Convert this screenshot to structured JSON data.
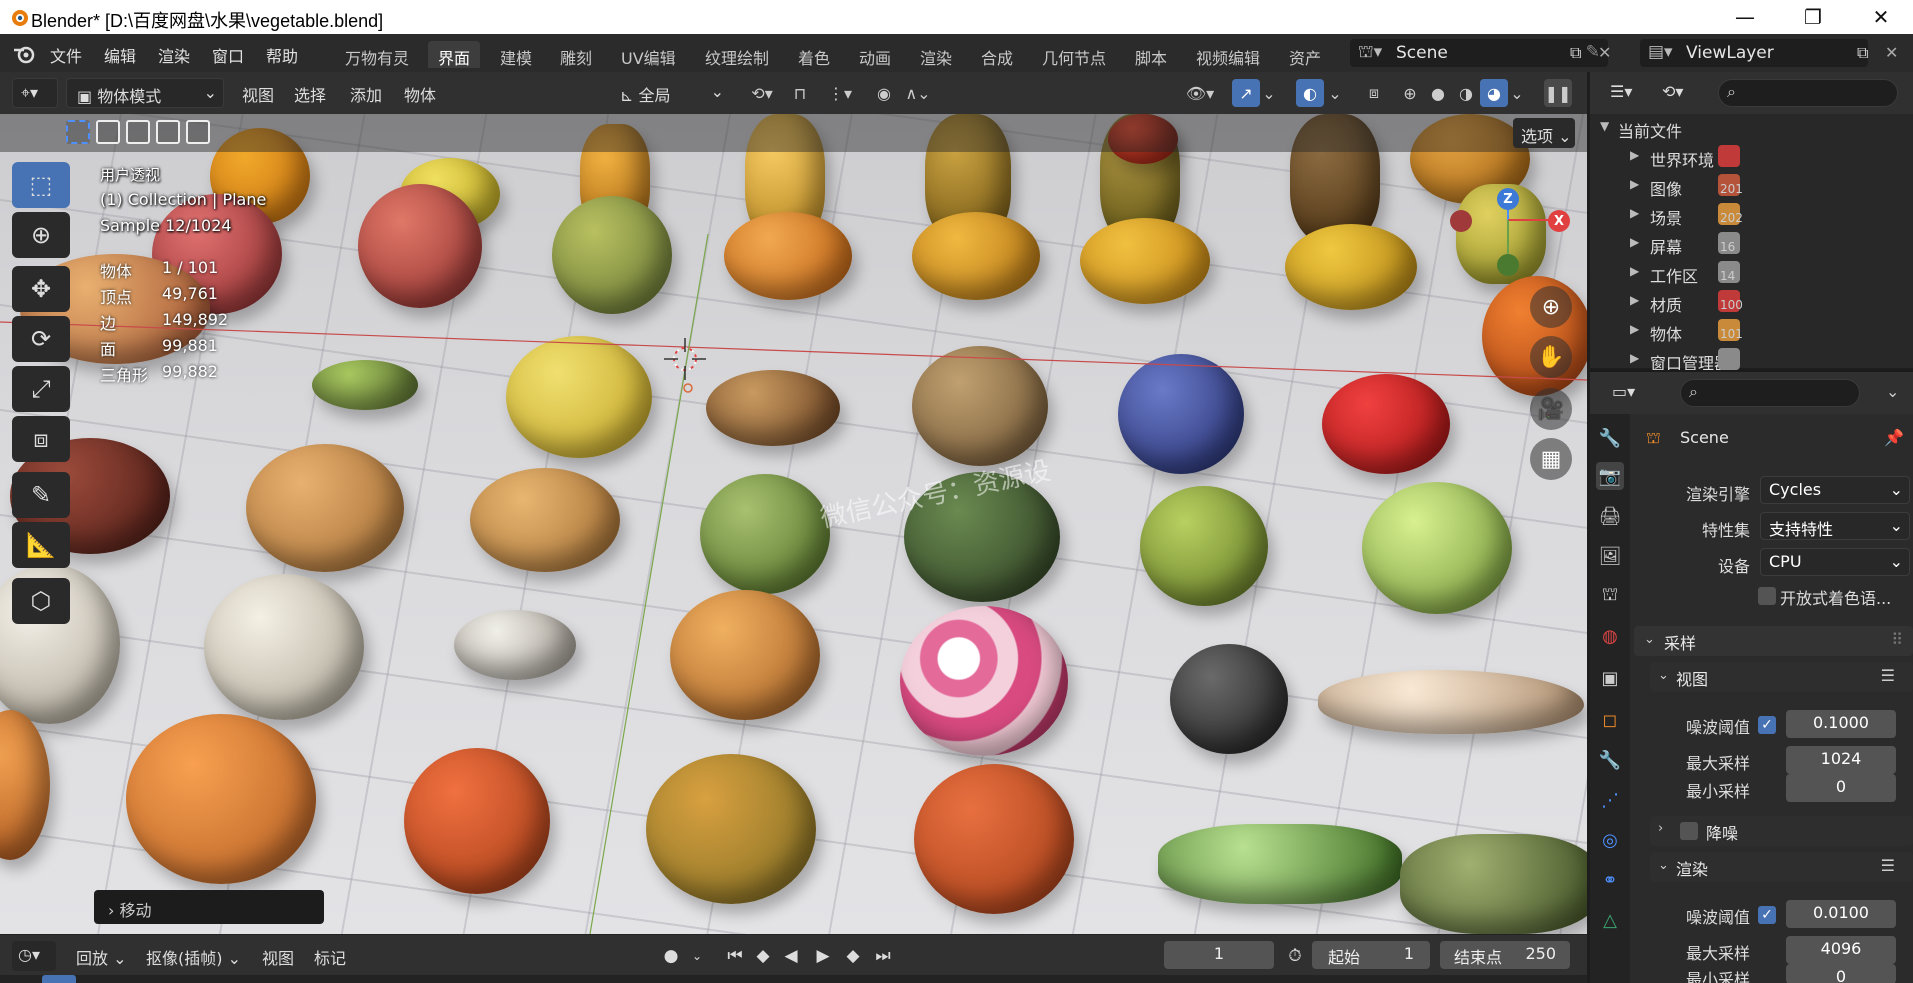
{
  "titlebar": {
    "title": "Blender* [D:\\百度网盘\\水果\\vegetable.blend]",
    "minimize": "—",
    "maximize": "❐",
    "close": "✕"
  },
  "menu": {
    "items": [
      "文件",
      "编辑",
      "渲染",
      "窗口",
      "帮助"
    ],
    "workspaces": [
      "万物有灵",
      "界面",
      "建模",
      "雕刻",
      "UV编辑",
      "纹理绘制",
      "着色",
      "动画",
      "渲染",
      "合成",
      "几何节点",
      "脚本",
      "视频编辑",
      "资产"
    ],
    "active_workspace": "界面",
    "scene": "Scene",
    "view_layer": "ViewLayer"
  },
  "viewport_header": {
    "mode": "物体模式",
    "menus": [
      "视图",
      "选择",
      "添加",
      "物体"
    ],
    "transform_orientation": "全局",
    "options_label": "选项"
  },
  "viewport": {
    "view_name": "用户透视",
    "collection": "(1) Collection | Plane",
    "sample": "Sample 12/1024",
    "stats": [
      {
        "label": "物体",
        "value": "1 / 101"
      },
      {
        "label": "顶点",
        "value": "49,761"
      },
      {
        "label": "边",
        "value": "149,892"
      },
      {
        "label": "面",
        "value": "99,881"
      },
      {
        "label": "三角形",
        "value": "99,882"
      }
    ],
    "last_operator": "移动",
    "watermark": "微信公众号：资源设",
    "gizmo": {
      "z": "Z",
      "x": "X"
    }
  },
  "timeline": {
    "playback": "回放",
    "keying": "抠像(插帧)",
    "view": "视图",
    "marker": "标记",
    "current_frame": "1",
    "start_label": "起始",
    "start": "1",
    "end_label": "结束点",
    "end": "250"
  },
  "outliner": {
    "root": "当前文件",
    "items": [
      {
        "label": "世界环境",
        "count": "",
        "color": "#c03a3a"
      },
      {
        "label": "图像",
        "count": "201",
        "color": "#b5533a"
      },
      {
        "label": "场景",
        "count": "202",
        "color": "#c98a3a"
      },
      {
        "label": "屏幕",
        "count": "16",
        "color": "#8a8a8a"
      },
      {
        "label": "工作区",
        "count": "14",
        "color": "#8a8a8a"
      },
      {
        "label": "材质",
        "count": "100",
        "color": "#c03a3a"
      },
      {
        "label": "物体",
        "count": "101",
        "color": "#c98a3a"
      },
      {
        "label": "窗口管理器",
        "count": "",
        "color": "#8a8a8a"
      }
    ]
  },
  "properties": {
    "context": "Scene",
    "render_engine_label": "渲染引擎",
    "render_engine": "Cycles",
    "feature_set_label": "特性集",
    "feature_set": "支持特性",
    "device_label": "设备",
    "device": "CPU",
    "osl_label": "开放式着色语...",
    "sampling_title": "采样",
    "viewport_title": "视图",
    "viewport_noise_label": "噪波阈值",
    "viewport_noise": "0.1000",
    "viewport_max_label": "最大采样",
    "viewport_max": "1024",
    "viewport_min_label": "最小采样",
    "viewport_min": "0",
    "denoise_label": "降噪",
    "render_title": "渲染",
    "render_noise_label": "噪波阈值",
    "render_noise": "0.0100",
    "render_max_label": "最大采样",
    "render_max": "4096",
    "render_min_label": "最小采样",
    "render_min": "0"
  }
}
